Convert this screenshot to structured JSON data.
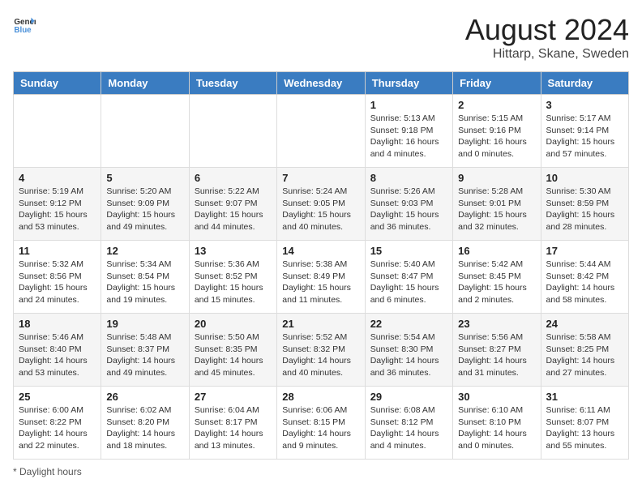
{
  "header": {
    "logo_general": "General",
    "logo_blue": "Blue",
    "main_title": "August 2024",
    "subtitle": "Hittarp, Skane, Sweden"
  },
  "days_of_week": [
    "Sunday",
    "Monday",
    "Tuesday",
    "Wednesday",
    "Thursday",
    "Friday",
    "Saturday"
  ],
  "weeks": [
    {
      "days": [
        {
          "number": "",
          "info": ""
        },
        {
          "number": "",
          "info": ""
        },
        {
          "number": "",
          "info": ""
        },
        {
          "number": "",
          "info": ""
        },
        {
          "number": "1",
          "info": "Sunrise: 5:13 AM\nSunset: 9:18 PM\nDaylight: 16 hours and 4 minutes."
        },
        {
          "number": "2",
          "info": "Sunrise: 5:15 AM\nSunset: 9:16 PM\nDaylight: 16 hours and 0 minutes."
        },
        {
          "number": "3",
          "info": "Sunrise: 5:17 AM\nSunset: 9:14 PM\nDaylight: 15 hours and 57 minutes."
        }
      ]
    },
    {
      "days": [
        {
          "number": "4",
          "info": "Sunrise: 5:19 AM\nSunset: 9:12 PM\nDaylight: 15 hours and 53 minutes."
        },
        {
          "number": "5",
          "info": "Sunrise: 5:20 AM\nSunset: 9:09 PM\nDaylight: 15 hours and 49 minutes."
        },
        {
          "number": "6",
          "info": "Sunrise: 5:22 AM\nSunset: 9:07 PM\nDaylight: 15 hours and 44 minutes."
        },
        {
          "number": "7",
          "info": "Sunrise: 5:24 AM\nSunset: 9:05 PM\nDaylight: 15 hours and 40 minutes."
        },
        {
          "number": "8",
          "info": "Sunrise: 5:26 AM\nSunset: 9:03 PM\nDaylight: 15 hours and 36 minutes."
        },
        {
          "number": "9",
          "info": "Sunrise: 5:28 AM\nSunset: 9:01 PM\nDaylight: 15 hours and 32 minutes."
        },
        {
          "number": "10",
          "info": "Sunrise: 5:30 AM\nSunset: 8:59 PM\nDaylight: 15 hours and 28 minutes."
        }
      ]
    },
    {
      "days": [
        {
          "number": "11",
          "info": "Sunrise: 5:32 AM\nSunset: 8:56 PM\nDaylight: 15 hours and 24 minutes."
        },
        {
          "number": "12",
          "info": "Sunrise: 5:34 AM\nSunset: 8:54 PM\nDaylight: 15 hours and 19 minutes."
        },
        {
          "number": "13",
          "info": "Sunrise: 5:36 AM\nSunset: 8:52 PM\nDaylight: 15 hours and 15 minutes."
        },
        {
          "number": "14",
          "info": "Sunrise: 5:38 AM\nSunset: 8:49 PM\nDaylight: 15 hours and 11 minutes."
        },
        {
          "number": "15",
          "info": "Sunrise: 5:40 AM\nSunset: 8:47 PM\nDaylight: 15 hours and 6 minutes."
        },
        {
          "number": "16",
          "info": "Sunrise: 5:42 AM\nSunset: 8:45 PM\nDaylight: 15 hours and 2 minutes."
        },
        {
          "number": "17",
          "info": "Sunrise: 5:44 AM\nSunset: 8:42 PM\nDaylight: 14 hours and 58 minutes."
        }
      ]
    },
    {
      "days": [
        {
          "number": "18",
          "info": "Sunrise: 5:46 AM\nSunset: 8:40 PM\nDaylight: 14 hours and 53 minutes."
        },
        {
          "number": "19",
          "info": "Sunrise: 5:48 AM\nSunset: 8:37 PM\nDaylight: 14 hours and 49 minutes."
        },
        {
          "number": "20",
          "info": "Sunrise: 5:50 AM\nSunset: 8:35 PM\nDaylight: 14 hours and 45 minutes."
        },
        {
          "number": "21",
          "info": "Sunrise: 5:52 AM\nSunset: 8:32 PM\nDaylight: 14 hours and 40 minutes."
        },
        {
          "number": "22",
          "info": "Sunrise: 5:54 AM\nSunset: 8:30 PM\nDaylight: 14 hours and 36 minutes."
        },
        {
          "number": "23",
          "info": "Sunrise: 5:56 AM\nSunset: 8:27 PM\nDaylight: 14 hours and 31 minutes."
        },
        {
          "number": "24",
          "info": "Sunrise: 5:58 AM\nSunset: 8:25 PM\nDaylight: 14 hours and 27 minutes."
        }
      ]
    },
    {
      "days": [
        {
          "number": "25",
          "info": "Sunrise: 6:00 AM\nSunset: 8:22 PM\nDaylight: 14 hours and 22 minutes."
        },
        {
          "number": "26",
          "info": "Sunrise: 6:02 AM\nSunset: 8:20 PM\nDaylight: 14 hours and 18 minutes."
        },
        {
          "number": "27",
          "info": "Sunrise: 6:04 AM\nSunset: 8:17 PM\nDaylight: 14 hours and 13 minutes."
        },
        {
          "number": "28",
          "info": "Sunrise: 6:06 AM\nSunset: 8:15 PM\nDaylight: 14 hours and 9 minutes."
        },
        {
          "number": "29",
          "info": "Sunrise: 6:08 AM\nSunset: 8:12 PM\nDaylight: 14 hours and 4 minutes."
        },
        {
          "number": "30",
          "info": "Sunrise: 6:10 AM\nSunset: 8:10 PM\nDaylight: 14 hours and 0 minutes."
        },
        {
          "number": "31",
          "info": "Sunrise: 6:11 AM\nSunset: 8:07 PM\nDaylight: 13 hours and 55 minutes."
        }
      ]
    }
  ],
  "footer": {
    "note": "Daylight hours"
  }
}
